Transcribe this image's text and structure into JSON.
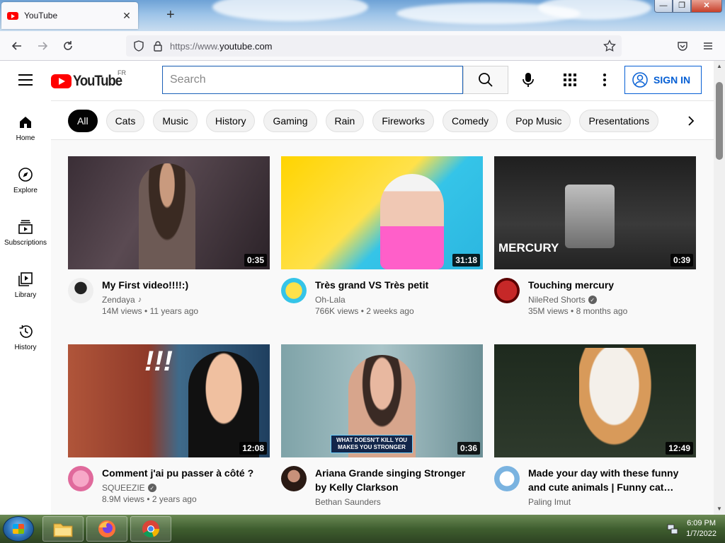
{
  "browser": {
    "tab_title": "YouTube",
    "tab_close": "✕",
    "new_tab": "+",
    "url_prefix": "https://www.",
    "url_domain": "youtube.com",
    "window_controls": [
      "—",
      "❐",
      "✕"
    ]
  },
  "header": {
    "logo_text": "YouTube",
    "region": "FR",
    "search_placeholder": "Search",
    "sign_in": "SIGN IN"
  },
  "guide": [
    {
      "label": "Home",
      "icon": "home-icon"
    },
    {
      "label": "Explore",
      "icon": "compass-icon"
    },
    {
      "label": "Subscriptions",
      "icon": "subscriptions-icon"
    },
    {
      "label": "Library",
      "icon": "library-icon"
    },
    {
      "label": "History",
      "icon": "history-icon"
    }
  ],
  "chips": [
    "All",
    "Cats",
    "Music",
    "History",
    "Gaming",
    "Rain",
    "Fireworks",
    "Comedy",
    "Pop Music",
    "Presentations"
  ],
  "videos": [
    {
      "title": "My First video!!!!:)",
      "channel": "Zendaya",
      "channel_badge": "music-note",
      "views": "14M views",
      "age": "11 years ago",
      "duration": "0:35"
    },
    {
      "title": "Très grand VS Très petit",
      "channel": "Oh-Lala",
      "views": "766K views",
      "age": "2 weeks ago",
      "duration": "31:18"
    },
    {
      "title": "Touching mercury",
      "channel": "NileRed Shorts",
      "channel_badge": "verified",
      "views": "35M views",
      "age": "8 months ago",
      "duration": "0:39",
      "thumb_caption": "MERCURY"
    },
    {
      "title": "Comment j'ai pu passer à côté ?",
      "channel": "SQUEEZIE",
      "channel_badge": "verified",
      "views": "8.9M views",
      "age": "2 years ago",
      "duration": "12:08",
      "thumb_caption": "!!!"
    },
    {
      "title": "Ariana Grande singing Stronger by Kelly Clarkson",
      "channel": "Bethan Saunders",
      "views": "",
      "age": "",
      "duration": "0:36",
      "thumb_caption": "WHAT DOESN'T KILL YOU MAKES YOU STRONGER"
    },
    {
      "title": "Made your day with these funny and cute animals | Funny cat…",
      "channel": "Paling Imut",
      "views": "",
      "age": "",
      "duration": "12:49"
    }
  ],
  "taskbar": {
    "time": "6:09 PM",
    "date": "1/7/2022"
  },
  "colors": {
    "brand_red": "#ff0000",
    "link_blue": "#065fd4",
    "chip_active": "#030303"
  }
}
